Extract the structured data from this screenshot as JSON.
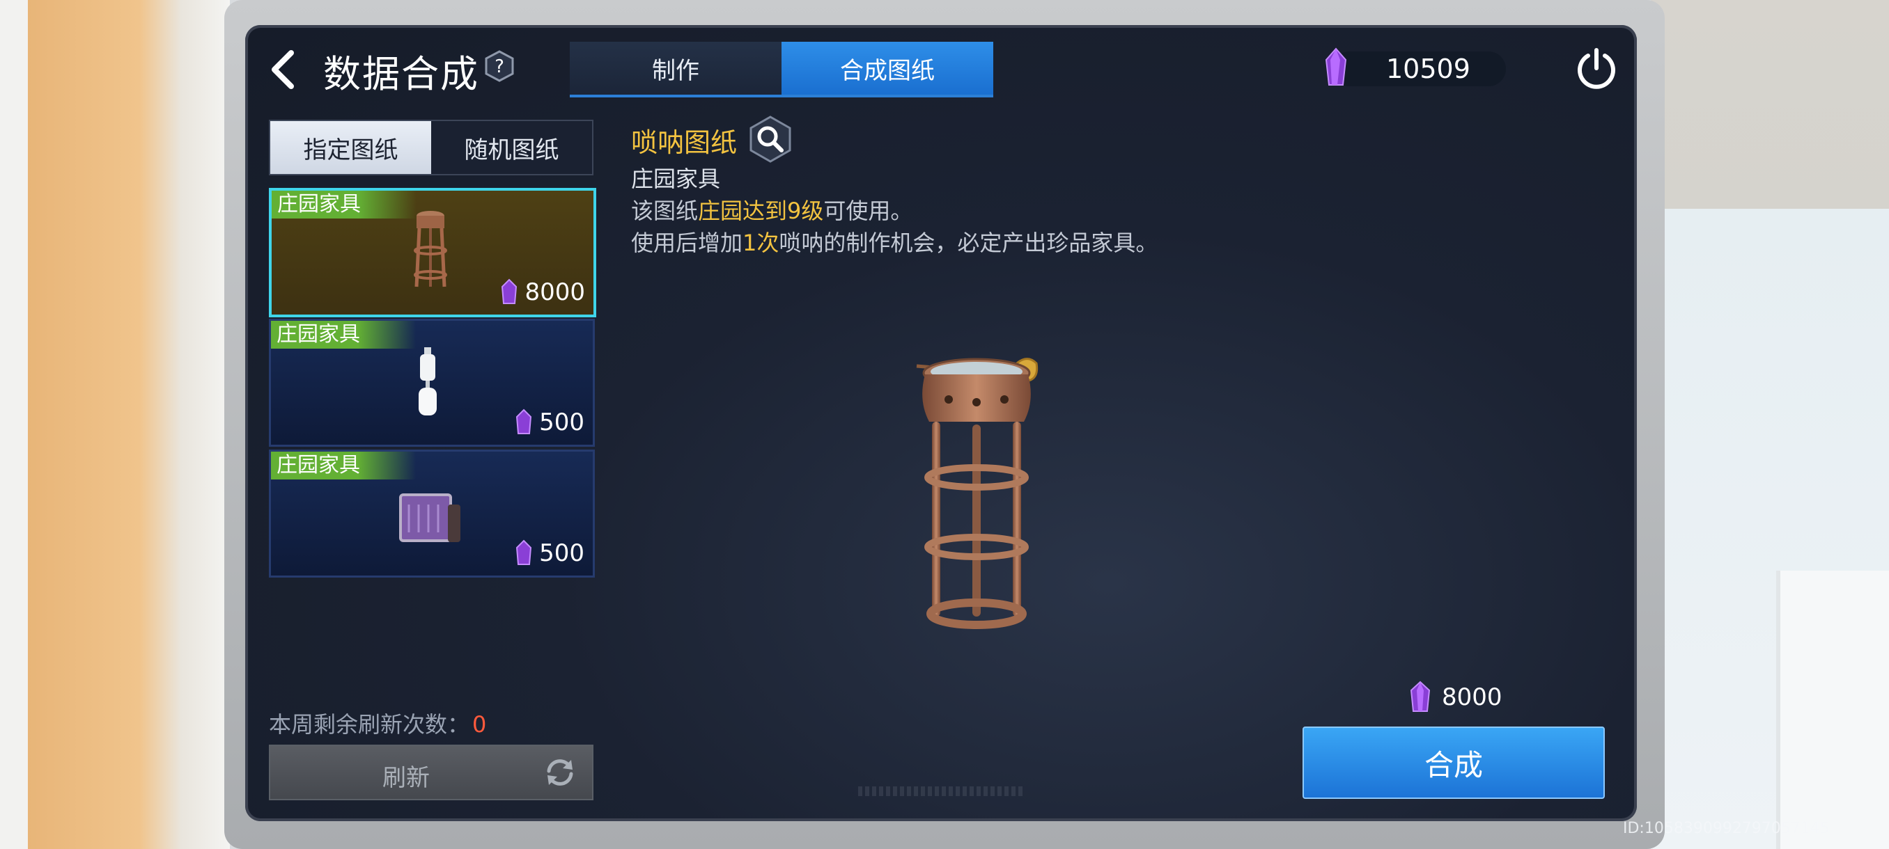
{
  "header": {
    "title": "数据合成",
    "help_icon": "?",
    "tabs": [
      {
        "label": "制作",
        "active": false
      },
      {
        "label": "合成图纸",
        "active": true
      }
    ],
    "currency_amount": "10509"
  },
  "left": {
    "sub_tabs": [
      {
        "label": "指定图纸",
        "active": true
      },
      {
        "label": "随机图纸",
        "active": false
      }
    ],
    "cards": [
      {
        "tag": "庄园家具",
        "price": "8000",
        "icon": "suona-stool-icon",
        "selected": true
      },
      {
        "tag": "庄园家具",
        "price": "500",
        "icon": "white-lamp-icon",
        "selected": false
      },
      {
        "tag": "庄园家具",
        "price": "500",
        "icon": "purple-box-icon",
        "selected": false
      }
    ],
    "refresh_label": "本周剩余刷新次数：",
    "refresh_count": "0",
    "refresh_button": "刷新"
  },
  "detail": {
    "name": "唢呐图纸",
    "category": "庄园家具",
    "line1_a": "该图纸",
    "line1_hl": "庄园达到9级",
    "line1_b": "可使用。",
    "line2_a": "使用后增加",
    "line2_hl": "1次",
    "line2_b": "唢呐的制作机会，必定产出珍品家具。",
    "cost": "8000",
    "compose_button": "合成"
  },
  "watermark": "ID:1058390992797057145",
  "colors": {
    "accent_blue": "#1c73d6",
    "highlight_yellow": "#f3c340",
    "tag_green": "#63b034",
    "selected_border": "#3fd5ea",
    "refresh_count_red": "#ff5a3c"
  }
}
